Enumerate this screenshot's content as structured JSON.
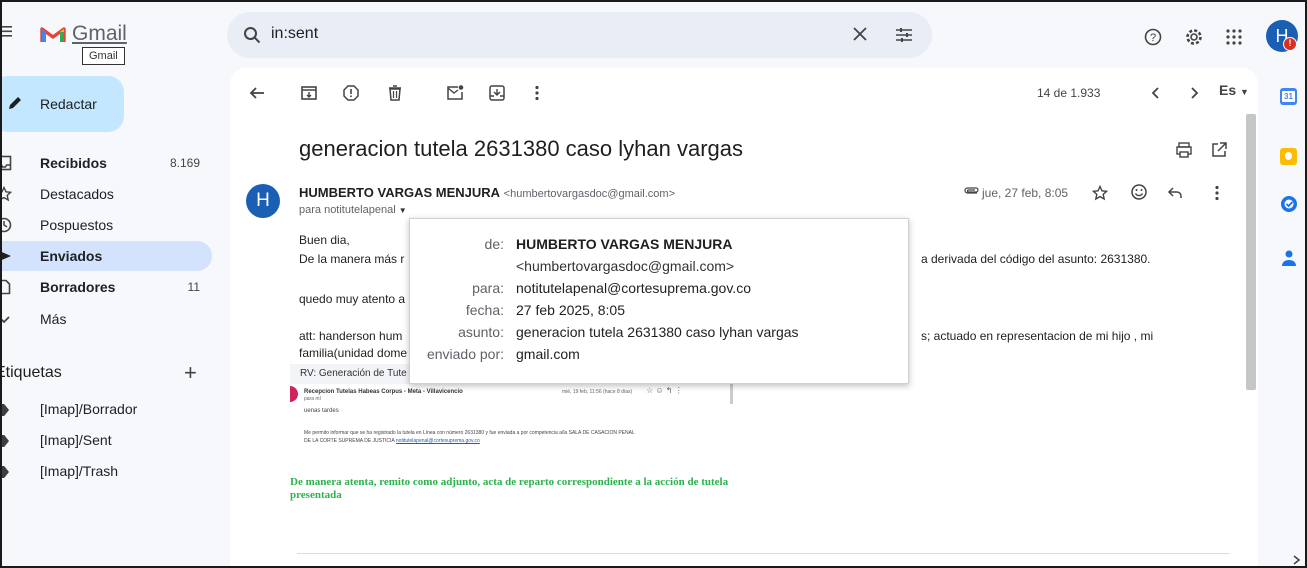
{
  "app": {
    "brand": "Gmail",
    "tooltip": "Gmail",
    "avatar_initial": "H"
  },
  "search": {
    "value": "in:sent"
  },
  "compose": {
    "label": "Redactar"
  },
  "sidebar": {
    "items": [
      {
        "label": "Recibidos",
        "count": "8.169",
        "icon": "inbox-icon"
      },
      {
        "label": "Destacados",
        "count": "",
        "icon": "star-icon"
      },
      {
        "label": "Pospuestos",
        "count": "",
        "icon": "clock-icon"
      },
      {
        "label": "Enviados",
        "count": "",
        "icon": "send-icon"
      },
      {
        "label": "Borradores",
        "count": "11",
        "icon": "draft-icon"
      },
      {
        "label": "Más",
        "count": "",
        "icon": "chevron-down-icon"
      }
    ],
    "labels_title": "Etiquetas",
    "labels": [
      "[Imap]/Borrador",
      "[Imap]/Sent",
      "[Imap]/Trash"
    ]
  },
  "toolbar": {
    "pagination": "14 de 1.933",
    "language": "Es"
  },
  "email": {
    "subject": "generacion tutela 2631380 caso lyhan vargas",
    "sender_initial": "H",
    "sender_name": "HUMBERTO VARGAS MENJURA",
    "sender_email": "<humbertovargasdoc@gmail.com>",
    "to_line": "para notitutelapenal",
    "date": "jue, 27 feb, 8:05",
    "body": {
      "greeting": "Buen dia,",
      "line1_start": "De la manera más r",
      "line1_end": "a derivada del código del asunto: 2631380.",
      "line2": "quedo muy atento a",
      "line3_start": "att: handerson hum",
      "line3_end": "s; actuado en representacion de mi hijo , mi",
      "line4": "familia(unidad dome"
    }
  },
  "details_popup": {
    "de_label": "de:",
    "de_name": "HUMBERTO VARGAS MENJURA",
    "de_email": "<humbertovargasdoc@gmail.com>",
    "para_label": "para:",
    "para_value": "notitutelapenal@cortesuprema.gov.co",
    "fecha_label": "fecha:",
    "fecha_value": "27 feb 2025, 8:05",
    "asunto_label": "asunto:",
    "asunto_value": "generacion tutela 2631380 caso lyhan vargas",
    "enviado_label": "enviado por:",
    "enviado_value": "gmail.com"
  },
  "embedded_image": {
    "header": "RV: Generación de Tute",
    "sender": "Recepcion Tutelas Habeas Corpus - Meta - Villavicencio",
    "date": "mié, 19 feb, 11:56 (hace 8 días)",
    "to": "para mí",
    "greeting": "uenas tardes",
    "line1": "Me permito informar que se ha registrado la tutela en Línea con número 2631380 y fue enviada a por competencia a/la SALA DE CASACION PENAL",
    "line2": "DE LA CORTE SUPREMA DE JUSTICIA",
    "link": "notitutelapenal@cortesuprema.gov.co",
    "highlight": "De manera atenta, remito como adjunto, acta de reparto correspondiente a la acción de tutela presentada"
  },
  "colors": {
    "accent": "#0b57d0",
    "avatar_bg": "#1a5fb4",
    "selected_nav": "#d3e3fd",
    "compose_bg": "#c2e7ff"
  }
}
